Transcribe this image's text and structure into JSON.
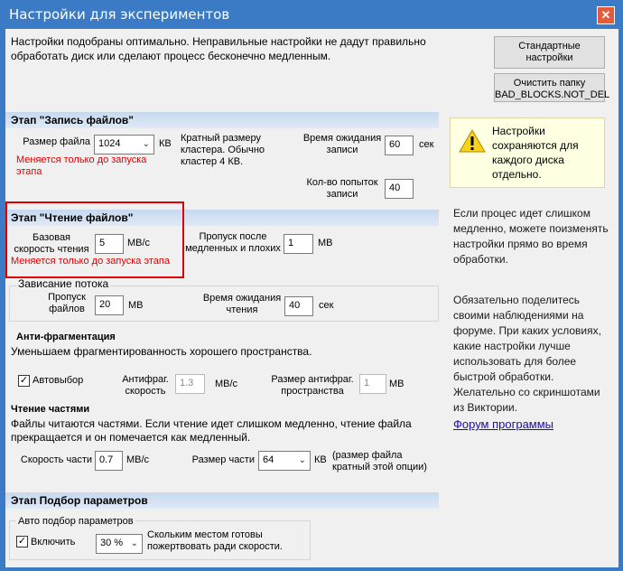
{
  "window": {
    "title": "Настройки для экспериментов",
    "close": "✕"
  },
  "intro": "Настройки подобраны оптимально. Неправильные настройки не дадут правильно обработать диск или сделают процесс бесконечно медленным.",
  "buttons": {
    "defaults": "Стандартные настройки",
    "clear": "Очистить папку BAD_BLOCKS.NOT_DEL"
  },
  "write": {
    "header": "Этап \"Запись файлов\"",
    "file_size_label": "Размер файла",
    "file_size_value": "1024",
    "file_size_unit": "КВ",
    "note": "Меняется только до запуска этапа",
    "cluster_note": "Кратный размеру кластера. Обычно кластер 4 КВ.",
    "wait_label": "Время ожидания записи",
    "wait_value": "60",
    "wait_unit": "сек",
    "tries_label": "Кол-во попыток записи",
    "tries_value": "40"
  },
  "read": {
    "header": "Этап \"Чтение файлов\"",
    "base_speed_label": "Базовая скорость чтения",
    "base_speed_value": "5",
    "base_speed_unit": "МВ/с",
    "note": "Меняется только до запуска этапа",
    "skip_label": "Пропуск после медленных и плохих",
    "skip_value": "1",
    "skip_unit": "МВ"
  },
  "hang": {
    "legend": "Зависание потока",
    "skip_label": "Пропуск файлов",
    "skip_value": "20",
    "skip_unit": "МВ",
    "wait_label": "Время ожидания чтения",
    "wait_value": "40",
    "wait_unit": "сек"
  },
  "antifrag": {
    "header": "Анти-фрагментация",
    "desc": "Уменьшаем фрагментированность хорошего пространства.",
    "auto_label": "Автовыбор",
    "auto_checked": "✓",
    "speed_label": "Антифраг. скорость",
    "speed_value": "1.3",
    "speed_unit": "МВ/с",
    "size_label": "Размер антифраг. пространства",
    "size_value": "1",
    "size_unit": "МВ"
  },
  "parts": {
    "header": "Чтение частями",
    "desc": "Файлы читаются частями. Если чтение идет слишком медленно, чтение файла прекращается и он помечается как медленный.",
    "speed_label": "Скорость части",
    "speed_value": "0.7",
    "speed_unit": "МВ/с",
    "size_label": "Размер части",
    "size_value": "64",
    "size_unit": "КВ",
    "size_note": "(размер файла кратный этой опции)"
  },
  "tuning": {
    "header": "Этап Подбор параметров",
    "legend": "Авто подбор параметров",
    "enable_label": "Включить",
    "enable_checked": "✓",
    "percent_value": "30 %",
    "percent_desc": "Скольким местом готовы пожертвовать ради скорости."
  },
  "side": {
    "warning": "Настройки сохраняются для каждого диска отдельно.",
    "slow": "Если процес идет слишком медленно, можете поизменять настройки прямо во время обработки.",
    "share": "Обязательно поделитесь своими наблюдениями на форуме. При каких условиях, какие настройки лучше использовать для более быстрой обработки. Желательно со скриншотами из Виктории.",
    "forum_link": "Форум программы"
  }
}
